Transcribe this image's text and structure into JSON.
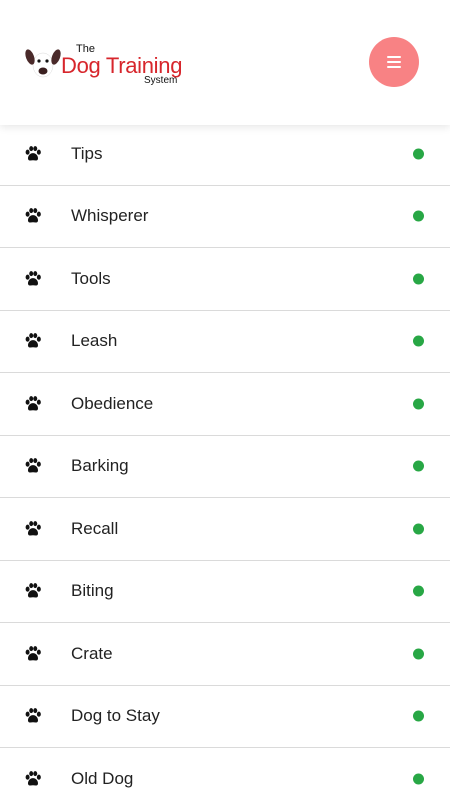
{
  "header": {
    "logo": {
      "the": "The",
      "main": "Dog Training",
      "sub": "System"
    },
    "menu_icon": "hamburger-icon",
    "menu_color": "#f88284"
  },
  "menu": {
    "status_color": "#28a745",
    "item_icon": "paw-icon",
    "items": [
      {
        "label": "Tips"
      },
      {
        "label": "Whisperer"
      },
      {
        "label": "Tools"
      },
      {
        "label": "Leash"
      },
      {
        "label": "Obedience"
      },
      {
        "label": "Barking"
      },
      {
        "label": "Recall"
      },
      {
        "label": "Biting"
      },
      {
        "label": "Crate"
      },
      {
        "label": "Dog to Stay"
      },
      {
        "label": "Old Dog"
      }
    ]
  }
}
